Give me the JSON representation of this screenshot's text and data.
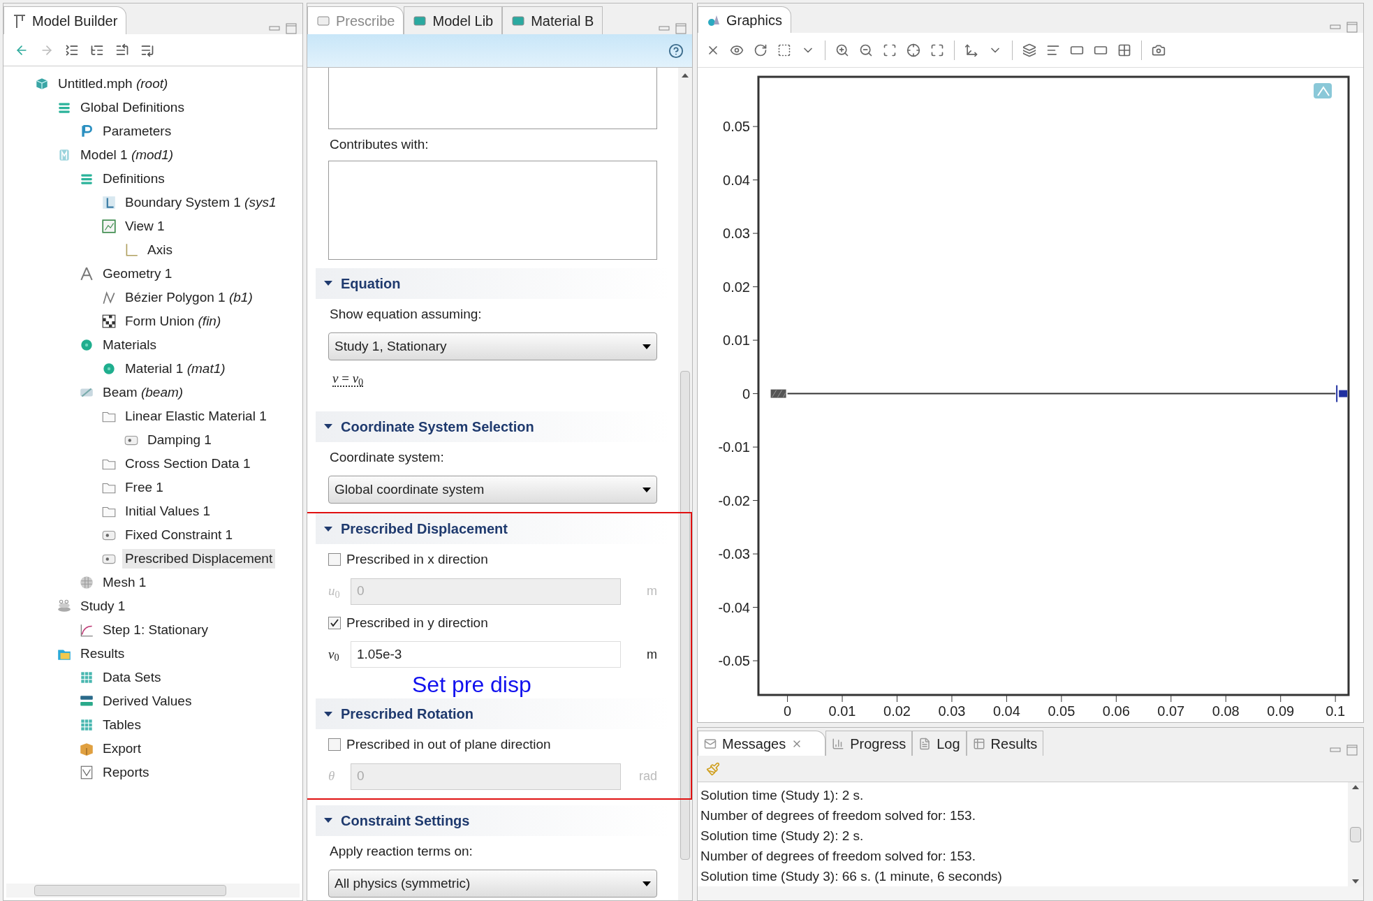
{
  "model_builder": {
    "title": "Model Builder",
    "tree": [
      {
        "label": "Untitled.mph *(root)*",
        "kind": "root",
        "selected": false,
        "children": [
          {
            "label": "Global Definitions",
            "kind": "list",
            "selected": false,
            "children": [
              {
                "label": "Parameters",
                "kind": "param",
                "selected": false
              }
            ]
          },
          {
            "label": "Model 1 *(mod1)*",
            "kind": "model",
            "selected": false,
            "children": [
              {
                "label": "Definitions",
                "kind": "list",
                "selected": false,
                "children": [
                  {
                    "label": "Boundary System 1 *(sys1*",
                    "kind": "coord",
                    "selected": false
                  },
                  {
                    "label": "View 1",
                    "kind": "view",
                    "selected": false,
                    "children": [
                      {
                        "label": "Axis",
                        "kind": "axis",
                        "selected": false
                      }
                    ]
                  }
                ]
              },
              {
                "label": "Geometry 1",
                "kind": "geometry",
                "selected": false,
                "children": [
                  {
                    "label": "Bézier Polygon 1 *(b1)*",
                    "kind": "bezier",
                    "selected": false
                  },
                  {
                    "label": "Form Union *(fin)*",
                    "kind": "union",
                    "selected": false
                  }
                ]
              },
              {
                "label": "Materials",
                "kind": "material",
                "selected": false,
                "children": [
                  {
                    "label": "Material 1 *(mat1)*",
                    "kind": "material",
                    "selected": false
                  }
                ]
              },
              {
                "label": "Beam *(beam)*",
                "kind": "beam",
                "selected": false,
                "children": [
                  {
                    "label": "Linear Elastic Material 1",
                    "kind": "folder",
                    "selected": false,
                    "children": [
                      {
                        "label": "Damping 1",
                        "kind": "constraint",
                        "selected": false
                      }
                    ]
                  },
                  {
                    "label": "Cross Section Data 1",
                    "kind": "folder",
                    "selected": false
                  },
                  {
                    "label": "Free 1",
                    "kind": "folder",
                    "selected": false
                  },
                  {
                    "label": "Initial Values 1",
                    "kind": "folder",
                    "selected": false
                  },
                  {
                    "label": "Fixed Constraint 1",
                    "kind": "constraint",
                    "selected": false
                  },
                  {
                    "label": "Prescribed Displacement",
                    "kind": "constraint",
                    "selected": true
                  }
                ]
              },
              {
                "label": "Mesh 1",
                "kind": "mesh",
                "selected": false
              }
            ]
          },
          {
            "label": "Study 1",
            "kind": "study",
            "selected": false,
            "children": [
              {
                "label": "Step 1: Stationary",
                "kind": "step",
                "selected": false
              }
            ]
          },
          {
            "label": "Results",
            "kind": "results",
            "selected": false,
            "children": [
              {
                "label": "Data Sets",
                "kind": "grid",
                "selected": false
              },
              {
                "label": "Derived Values",
                "kind": "derived",
                "selected": false
              },
              {
                "label": "Tables",
                "kind": "grid",
                "selected": false
              },
              {
                "label": "Export",
                "kind": "export",
                "selected": false
              },
              {
                "label": "Reports",
                "kind": "reports",
                "selected": false
              }
            ]
          }
        ]
      }
    ]
  },
  "settings": {
    "tabs": [
      {
        "label": "Prescribe",
        "selected": true
      },
      {
        "label": "Model Lib",
        "selected": false
      },
      {
        "label": "Material B",
        "selected": false
      }
    ],
    "top_items": [
      {
        "kind": "textarea"
      },
      {
        "kind": "label",
        "text": "Contributes with:"
      },
      {
        "kind": "textarea",
        "tall": true
      }
    ],
    "sections": [
      {
        "title": "Equation",
        "expanded": true,
        "highlighted": false,
        "items": [
          {
            "kind": "label",
            "text": "Show equation assuming:"
          },
          {
            "kind": "select",
            "value": "Study 1, Stationary"
          },
          {
            "kind": "equation",
            "text": "*v* = *v*$_{0}$"
          }
        ]
      },
      {
        "title": "Coordinate System Selection",
        "expanded": true,
        "highlighted": false,
        "items": [
          {
            "kind": "label",
            "text": "Coordinate system:"
          },
          {
            "kind": "select",
            "value": "Global coordinate system"
          }
        ]
      },
      {
        "title": "Prescribed Displacement",
        "expanded": true,
        "highlighted": true,
        "items": [
          {
            "kind": "checkbox",
            "text": "Prescribed in x direction",
            "checked": false
          },
          {
            "kind": "field",
            "symbol": "*u*$_{0}$",
            "value": "0",
            "unit": "m",
            "disabled": true
          },
          {
            "kind": "checkbox",
            "text": "Prescribed in y direction",
            "checked": true
          },
          {
            "kind": "field",
            "symbol": "*v*$_{0}$",
            "value": "1.05e-3",
            "unit": "m",
            "disabled": false
          }
        ]
      },
      {
        "title": "Prescribed Rotation",
        "expanded": true,
        "highlighted": true,
        "items": [
          {
            "kind": "checkbox",
            "text": "Prescribed in out of plane direction",
            "checked": false
          },
          {
            "kind": "field",
            "symbol": "*θ*",
            "value": "0",
            "unit": "rad",
            "disabled": true
          }
        ]
      },
      {
        "title": "Constraint Settings",
        "expanded": true,
        "highlighted": false,
        "items": [
          {
            "kind": "label",
            "text": "Apply reaction terms on:"
          },
          {
            "kind": "select",
            "value": "All physics (symmetric)"
          }
        ]
      }
    ],
    "annotation": "Set pre disp"
  },
  "graphics": {
    "title": "Graphics",
    "chart_data": {
      "type": "line",
      "x": [
        0,
        0.1
      ],
      "series": [
        {
          "color": "#333333",
          "values": [
            0,
            0
          ]
        }
      ],
      "xlim": [
        -0.0053,
        0.1024
      ],
      "ylim": [
        -0.0564,
        0.0593
      ],
      "xticks": [
        0,
        0.01,
        0.02,
        0.03,
        0.04,
        0.05,
        0.06,
        0.07,
        0.08,
        0.09,
        0.1
      ],
      "yticks": [
        -0.05,
        -0.04,
        -0.03,
        -0.02,
        -0.01,
        0,
        0.01,
        0.02,
        0.03,
        0.04,
        0.05
      ]
    }
  },
  "messages": {
    "tabs": [
      {
        "label": "Messages",
        "selected": true,
        "closable": true
      },
      {
        "label": "Progress",
        "selected": false,
        "closable": false
      },
      {
        "label": "Log",
        "selected": false,
        "closable": false
      },
      {
        "label": "Results",
        "selected": false,
        "closable": false
      }
    ],
    "lines": [
      "Solution time (Study 1): 2 s.",
      "Number of degrees of freedom solved for: 153.",
      "Solution time (Study 2): 2 s.",
      "Number of degrees of freedom solved for: 153.",
      "Solution time (Study 3): 66 s. (1 minute, 6 seconds)"
    ]
  }
}
